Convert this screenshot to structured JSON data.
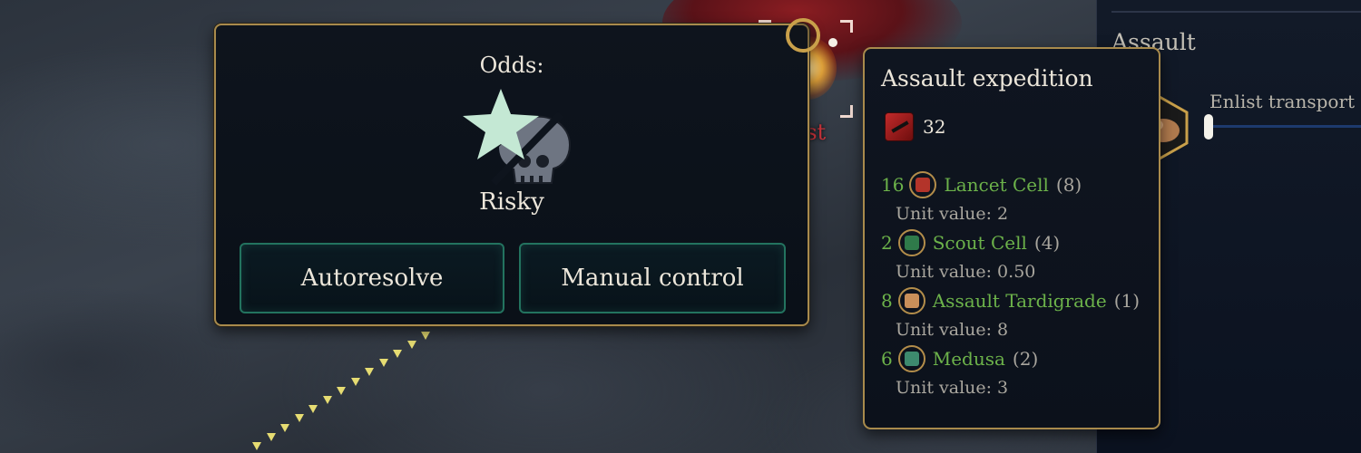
{
  "map": {
    "location_label": "Nest"
  },
  "odds_popup": {
    "title": "Odds:",
    "result": "Risky",
    "icon": "star-skull-odds-icon",
    "buttons": {
      "autoresolve": "Autoresolve",
      "manual": "Manual control"
    }
  },
  "expedition": {
    "title": "Assault expedition",
    "power_icon": "attack-power-icon",
    "power_value": "32",
    "units": [
      {
        "count": "16",
        "name": "Lancet Cell",
        "paren": "(8)",
        "value_text": "Unit value: 2",
        "icon": "lancet-cell-icon",
        "icon_color": "#b3342a"
      },
      {
        "count": "2",
        "name": "Scout Cell",
        "paren": "(4)",
        "value_text": "Unit value: 0.50",
        "icon": "scout-cell-icon",
        "icon_color": "#2f7a4a"
      },
      {
        "count": "8",
        "name": "Assault Tardigrade",
        "paren": "(1)",
        "value_text": "Unit value: 8",
        "icon": "assault-tardigrade-icon",
        "icon_color": "#c98f5a"
      },
      {
        "count": "6",
        "name": "Medusa",
        "paren": "(2)",
        "value_text": "Unit value: 3",
        "icon": "medusa-icon",
        "icon_color": "#3d8a6e"
      }
    ]
  },
  "side_panel": {
    "title": "Assault",
    "enlist_label": "Enlist transport",
    "enlist_level": 0
  },
  "colors": {
    "unit_green": "#6cb24a",
    "gold_border": "#a88a4c",
    "button_border": "#23735f",
    "nest_red": "#c9333a"
  }
}
